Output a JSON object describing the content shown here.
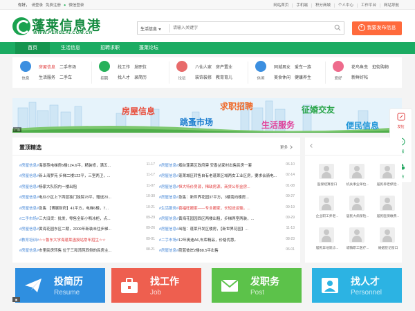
{
  "topbar": {
    "greeting": "你好，",
    "login": "请登录",
    "register": "免费注册",
    "wechat_login": "微信登录",
    "right_links": [
      "网站首页",
      "手机端",
      "积分商城",
      "个人中心",
      "工作平台",
      "网站导航"
    ]
  },
  "logo": {
    "text": "蓬莱信息港",
    "url": "WWW.PENGLAI.COM.CN"
  },
  "search": {
    "category": "生活信息",
    "placeholder": "请输入关键字"
  },
  "post_button": "我要发布信息",
  "nav": [
    "首页",
    "生活信息",
    "招聘求职",
    "蓬莱论坛"
  ],
  "categories": [
    {
      "icon_label": "信息",
      "icon_color": "#3c8fe0",
      "links": [
        [
          "房屋信息",
          "二手市场"
        ],
        [
          "生活服务",
          "二手车"
        ]
      ],
      "hl": "房屋信息"
    },
    {
      "icon_label": "招聘",
      "icon_color": "#27b15b",
      "links": [
        [
          "找工作",
          "发职位"
        ],
        [
          "找人才",
          "录简历"
        ]
      ],
      "hl": ""
    },
    {
      "icon_label": "论坛",
      "icon_color": "#e86b6b",
      "links": [
        [
          "八仙人家",
          "房产置业"
        ],
        [
          "装饰装修",
          "教育育儿"
        ]
      ],
      "hl": ""
    },
    {
      "icon_label": "休闲",
      "icon_color": "#3c8fe0",
      "links": [
        [
          "同城男女",
          "爱车一族"
        ],
        [
          "美食休闲",
          "健康养生"
        ]
      ],
      "hl": ""
    },
    {
      "icon_label": "爱好",
      "icon_color": "#ee6b8c",
      "links": [
        [
          "花鸟鱼虫",
          "逛街购物"
        ],
        [
          "新鲜好帖",
          ""
        ]
      ],
      "hl": ""
    }
  ],
  "banner": {
    "words": [
      "房屋信息",
      "求职招聘",
      "征婚交友",
      "跳蚤市场",
      "生活服务",
      "便民信息"
    ],
    "corner": "广告"
  },
  "side_float": [
    "发帖",
    "客服",
    "微信"
  ],
  "top_section": {
    "title": "置顶精选",
    "more": "更多",
    "left_rows": [
      {
        "tag": "#房屋信息#",
        "text": "海景苑电梯房6楼124.6平，精装修，满五...",
        "date": "11-17",
        "red": false
      },
      {
        "tag": "#房屋信息#",
        "text": "新上海梦苑 步梯二楼122平，三室两卫，...",
        "date": "11-17",
        "red": false
      },
      {
        "tag": "#房屋信息#",
        "text": "杨家大队院内一楼出租",
        "date": "11-07",
        "red": false
      },
      {
        "tag": "#房屋信息#",
        "text": "电业小区上下两层独门独院78平，赠送20...",
        "date": "10-30",
        "red": false
      },
      {
        "tag": "#房屋信息#",
        "text": "急售 【博展财府】41平方，电梯6楼，7...",
        "date": "10-21",
        "red": false
      },
      {
        "tag": "#二手市场#",
        "text": "三大旧货：批发，零售全新小鸭冰柜，点...",
        "date": "09-29",
        "red": false
      },
      {
        "tag": "#房屋信息#",
        "text": "黄海花园东区二期，2009年新装未住步梯...",
        "date": "09-26",
        "red": false
      },
      {
        "tag": "#教育培训#",
        "text": "☆☆鲁东大学海蓬莱函授站常年招生☆☆",
        "date": "09-01",
        "red": true
      },
      {
        "tag": "#房屋信息#",
        "text": "市里民房转售 位于三和湾苑西侧的民房主...",
        "date": "08-21",
        "red": false
      }
    ],
    "right_rows": [
      {
        "tag": "#房屋信息#",
        "text": "烟台蓬莱区政府旁 安香丛家村出售民房一套",
        "date": "06-10",
        "red": false
      },
      {
        "tag": "#房屋信息#",
        "text": "蓬莱城区转售自有老蓬莱区域两女工业区房，要求会骑电...",
        "date": "02-14",
        "red": false
      },
      {
        "tag": "#房屋信息#",
        "text": "恒大特价房源，稀缺房源，商贷公积金房...",
        "date": "01-08",
        "red": true
      },
      {
        "tag": "#房屋信息#",
        "text": "急售：新世界花园37平方，3楼南向楼房...",
        "date": "09-27",
        "red": false
      },
      {
        "tag": "#生活服务#",
        "text": "喜福旺搬家——专业搬家，长短途运输，...",
        "date": "09-19",
        "red": true
      },
      {
        "tag": "#房屋信息#",
        "text": "黄海花园园西区两楼出租，步梯两室两装，...",
        "date": "09-29",
        "red": false
      },
      {
        "tag": "#房屋信息#",
        "text": "出租：蓬莱开发区楼房，【新世界花园】...",
        "date": "11-13",
        "red": false
      },
      {
        "tag": "#二手市场#",
        "text": "12年奥迪A6,车库精品，价格优惠。",
        "date": "08-23",
        "red": false
      },
      {
        "tag": "#房屋信息#",
        "text": "蔚蓝彼岸2楼88.5平出售",
        "date": "06-01",
        "red": false
      }
    ]
  },
  "members": [
    "医保结算窗口",
    "机关事业单位...",
    "居民养老保险...",
    "企业职工养老...",
    "居民大病保险...",
    "居民医保缴费...",
    "居民异地就诊...",
    "城镇职工医疗...",
    "婚姻登记窗口"
  ],
  "big_buttons": [
    {
      "title": "投简历",
      "sub": "Resume",
      "color": "#2f8fe0"
    },
    {
      "title": "找工作",
      "sub": "Job",
      "color": "#ee5f4f"
    },
    {
      "title": "发职务",
      "sub": "Post",
      "color": "#5cc24a"
    },
    {
      "title": "找人才",
      "sub": "Personnel",
      "color": "#2cb3e3"
    }
  ]
}
